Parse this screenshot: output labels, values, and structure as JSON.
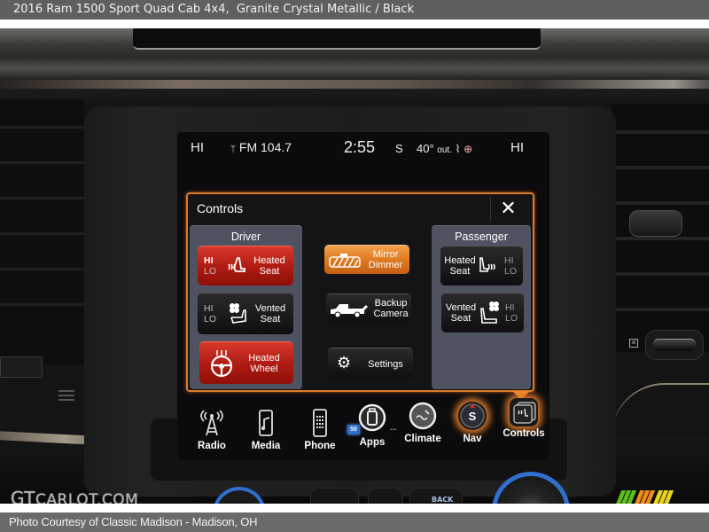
{
  "captions": {
    "top": "2016 Ram 1500 Sport Quad Cab 4x4,  Granite Crystal Metallic / Black",
    "bottom": "Photo Courtesy of Classic Madison - Madison, OH"
  },
  "watermark": {
    "brand_big": "GT",
    "brand_rest": "CARLOT.COM",
    "logo_colors": [
      "#5cbf1e",
      "#5cbf1e",
      "#5cbf1e",
      "#f08c1e",
      "#f08c1e",
      "#f08c1e",
      "#e8d41a",
      "#e8d41a",
      "#e8d41a"
    ]
  },
  "dash": {
    "back_button_label": "BACK"
  },
  "status_bar": {
    "left_seat_level": "HI",
    "radio_icon": "antenna-icon",
    "radio": "FM 104.7",
    "time": "2:55",
    "compass": "S",
    "temperature": "40°",
    "temperature_suffix": "out.",
    "right_seat_level": "HI"
  },
  "controls": {
    "title": "Controls",
    "close_label": "✕",
    "accent": "#e07a2a",
    "driver": {
      "title": "Driver",
      "heated_seat": {
        "label_1": "Heated",
        "label_2": "Seat",
        "hi": "HI",
        "lo": "LO",
        "state": "HI"
      },
      "vented_seat": {
        "label_1": "Vented",
        "label_2": "Seat",
        "hi": "HI",
        "lo": "LO",
        "state": "off"
      },
      "heated_wheel": {
        "label_1": "Heated",
        "label_2": "Wheel",
        "state": "on"
      }
    },
    "center": {
      "mirror_dimmer": {
        "label_1": "Mirror",
        "label_2": "Dimmer",
        "state": "on"
      },
      "backup_camera": {
        "label_1": "Backup",
        "label_2": "Camera"
      },
      "settings": {
        "label": "Settings"
      }
    },
    "passenger": {
      "title": "Passenger",
      "heated_seat": {
        "label_1": "Heated",
        "label_2": "Seat",
        "hi": "HI",
        "lo": "LO",
        "state": "off"
      },
      "vented_seat": {
        "label_1": "Vented",
        "label_2": "Seat",
        "hi": "HI",
        "lo": "LO",
        "state": "off"
      }
    }
  },
  "dock": {
    "items": [
      {
        "label": "Radio",
        "icon": "radio-tower-icon"
      },
      {
        "label": "Media",
        "icon": "media-phone-icon"
      },
      {
        "label": "Phone",
        "icon": "phone-keypad-icon"
      },
      {
        "label": "Apps",
        "icon": "apps-icon",
        "badge": "50",
        "more": "..."
      },
      {
        "label": "Climate",
        "icon": "climate-icon"
      },
      {
        "label": "Nav",
        "icon": "compass-icon",
        "compass_letter": "S"
      },
      {
        "label": "Controls",
        "icon": "controls-icon",
        "active": true
      }
    ]
  }
}
